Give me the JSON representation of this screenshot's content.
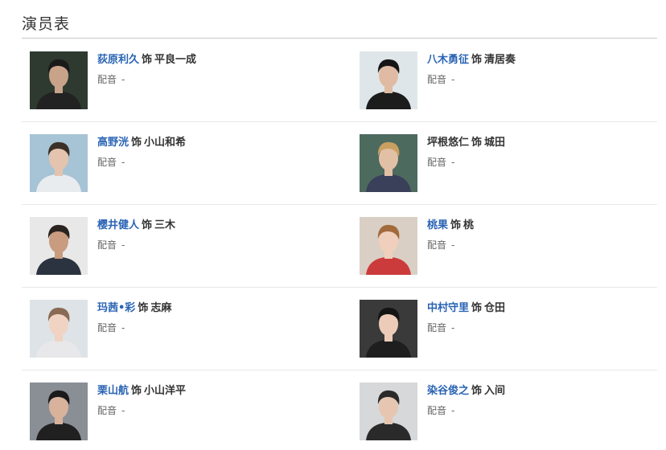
{
  "section": {
    "title": "演员表"
  },
  "cast": [
    {
      "actor": "荻原利久",
      "as": "饰",
      "role": "平良一成",
      "voice_label": "配音",
      "voice": "-",
      "link": true,
      "photo": {
        "bg": "#2e3a30",
        "skin": "#c9a28a",
        "hair": "#1a1a1a",
        "cloth": "#222222"
      }
    },
    {
      "actor": "八木勇征",
      "as": "饰",
      "role": "清居奏",
      "voice_label": "配音",
      "voice": "-",
      "link": true,
      "photo": {
        "bg": "#dfe6ea",
        "skin": "#e0bba4",
        "hair": "#161616",
        "cloth": "#1c1c1c"
      }
    },
    {
      "actor": "高野洸",
      "as": "饰",
      "role": "小山和希",
      "voice_label": "配音",
      "voice": "-",
      "link": true,
      "photo": {
        "bg": "#a7c3d6",
        "skin": "#e4c4ae",
        "hair": "#3b3028",
        "cloth": "#e9ecef"
      }
    },
    {
      "actor": "坪根悠仁",
      "as": "饰",
      "role": "城田",
      "voice_label": "配音",
      "voice": "-",
      "link": false,
      "photo": {
        "bg": "#4d6a5e",
        "skin": "#e2c0a6",
        "hair": "#c9a060",
        "cloth": "#3a3f5a"
      }
    },
    {
      "actor": "樱井健人",
      "as": "饰",
      "role": "三木",
      "voice_label": "配音",
      "voice": "-",
      "link": true,
      "photo": {
        "bg": "#e8e8e8",
        "skin": "#c99b7f",
        "hair": "#2a2420",
        "cloth": "#2b3340"
      }
    },
    {
      "actor": "桃果",
      "as": "饰",
      "role": "桃",
      "voice_label": "配音",
      "voice": "-",
      "link": true,
      "photo": {
        "bg": "#d9cfc4",
        "skin": "#f0cfbd",
        "hair": "#a36a3c",
        "cloth": "#cc3b3b"
      }
    },
    {
      "actor": "玛茜•彩",
      "as": "饰",
      "role": "志麻",
      "voice_label": "配音",
      "voice": "-",
      "link": true,
      "photo": {
        "bg": "#dde3e6",
        "skin": "#f0d3c2",
        "hair": "#8a6a54",
        "cloth": "#e8e8ea"
      }
    },
    {
      "actor": "中村守里",
      "as": "饰",
      "role": "仓田",
      "voice_label": "配音",
      "voice": "-",
      "link": true,
      "photo": {
        "bg": "#3a3a3a",
        "skin": "#ecccb8",
        "hair": "#141414",
        "cloth": "#1e1e1e"
      }
    },
    {
      "actor": "栗山航",
      "as": "饰",
      "role": "小山洋平",
      "voice_label": "配音",
      "voice": "-",
      "link": true,
      "photo": {
        "bg": "#8a8f96",
        "skin": "#d8b29a",
        "hair": "#1a1a1a",
        "cloth": "#202020"
      }
    },
    {
      "actor": "染谷俊之",
      "as": "饰",
      "role": "入间",
      "voice_label": "配音",
      "voice": "-",
      "link": true,
      "photo": {
        "bg": "#d6d8da",
        "skin": "#e6c6b0",
        "hair": "#2a2a2a",
        "cloth": "#2a2a2a"
      }
    }
  ]
}
